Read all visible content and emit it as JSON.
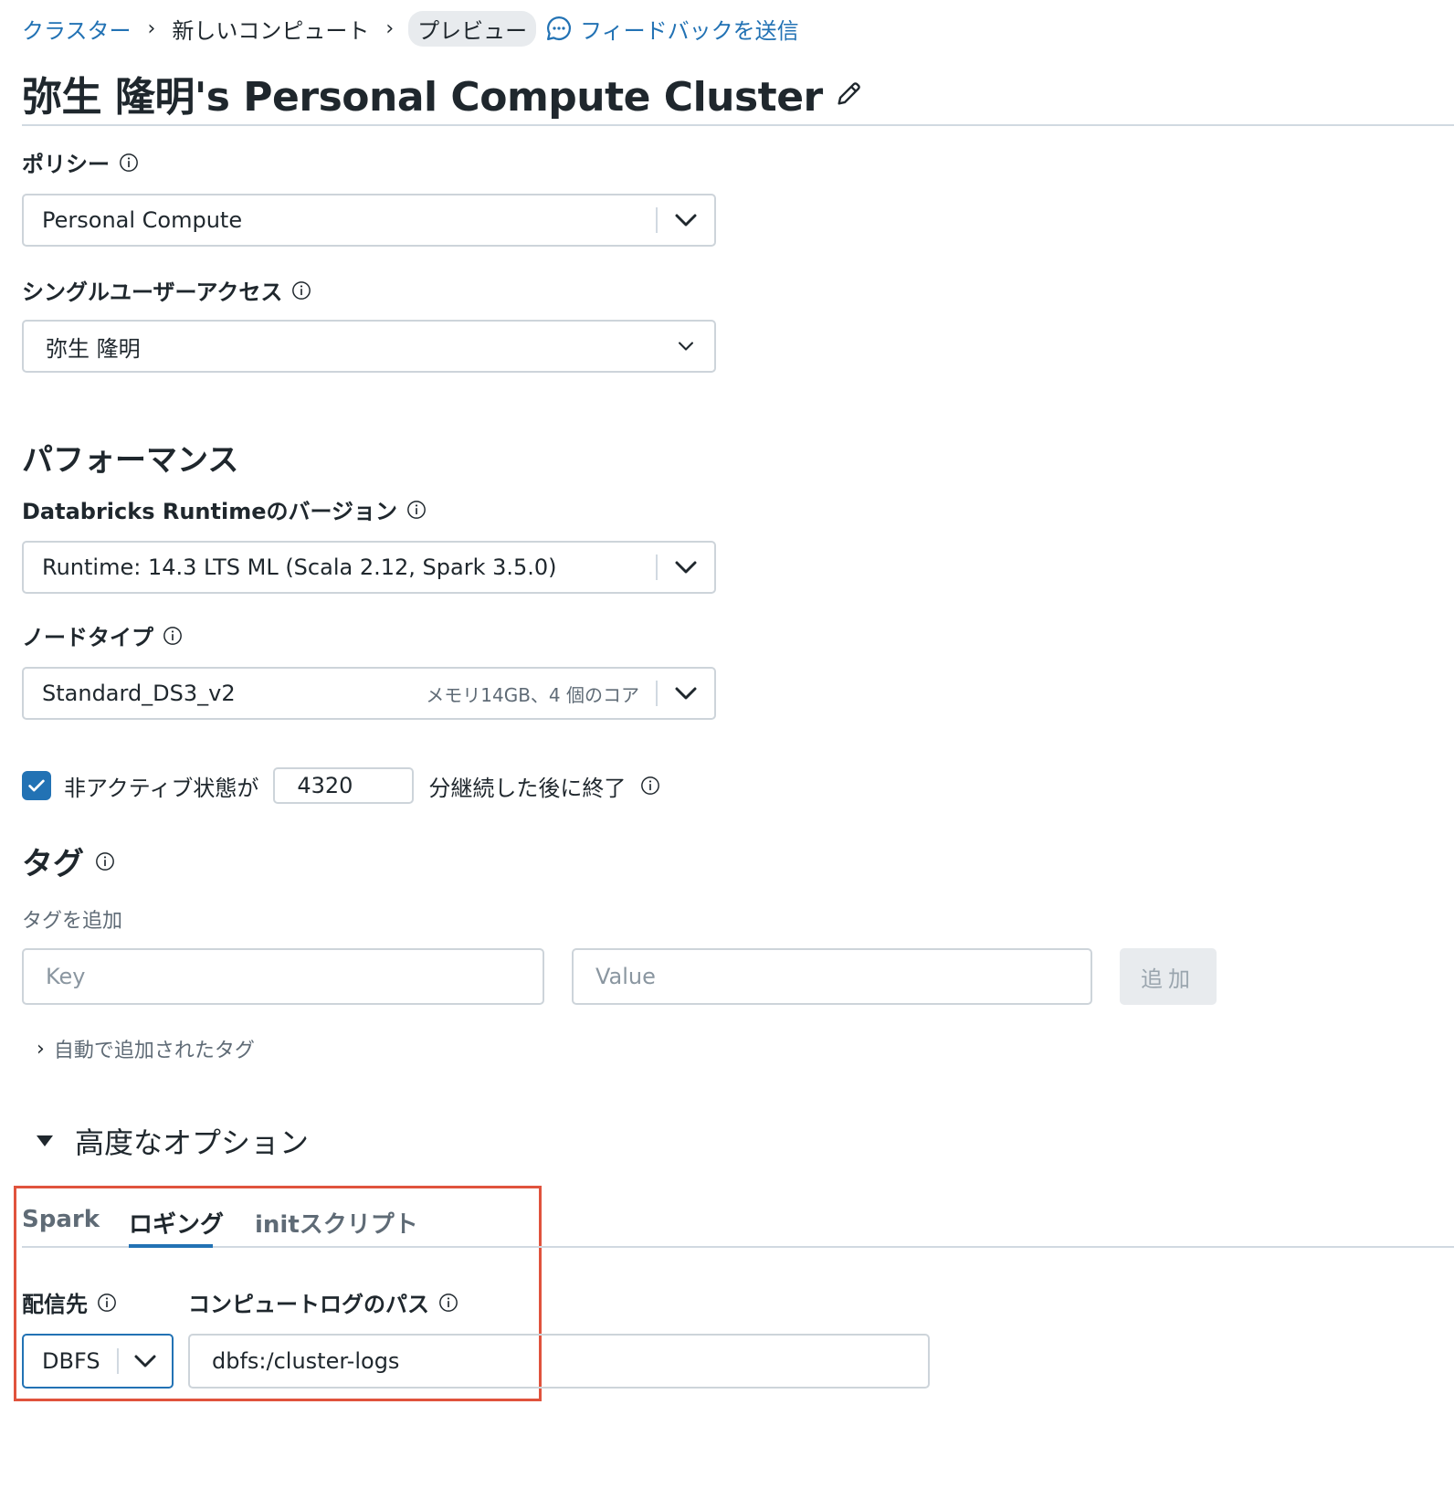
{
  "breadcrumb": {
    "clusters": "クラスター",
    "sep": "›",
    "new_compute": "新しいコンピュート",
    "preview": "プレビュー",
    "feedback": "フィードバックを送信"
  },
  "title": "弥生 隆明's Personal Compute Cluster",
  "policy": {
    "label": "ポリシー",
    "value": "Personal Compute"
  },
  "single_user": {
    "label": "シングルユーザーアクセス",
    "value": "弥生 隆明"
  },
  "performance": {
    "heading": "パフォーマンス",
    "runtime_label": "Databricks Runtimeのバージョン",
    "runtime_value": "Runtime: 14.3 LTS ML (Scala 2.12, Spark 3.5.0)",
    "node_label": "ノードタイプ",
    "node_value": "Standard_DS3_v2",
    "node_hint": "メモリ14GB、4 個のコア"
  },
  "termination": {
    "checked": true,
    "prefix": "非アクティブ状態が",
    "minutes": "4320",
    "suffix": "分継続した後に終了"
  },
  "tags": {
    "heading": "タグ",
    "add_label": "タグを追加",
    "key_placeholder": "Key",
    "value_placeholder": "Value",
    "add_button": "追加",
    "auto_tags": "自動で追加されたタグ",
    "auto_chevron": "›"
  },
  "advanced": {
    "heading": "高度なオプション",
    "tabs": [
      "Spark",
      "ロギング",
      "initスクリプト"
    ],
    "active_tab": 1,
    "destination_label": "配信先",
    "destination_value": "DBFS",
    "log_path_label": "コンピュートログのパス",
    "log_path_value": "dbfs:/cluster-logs"
  },
  "colors": {
    "accent": "#2272b4",
    "highlight": "#e0533d"
  }
}
